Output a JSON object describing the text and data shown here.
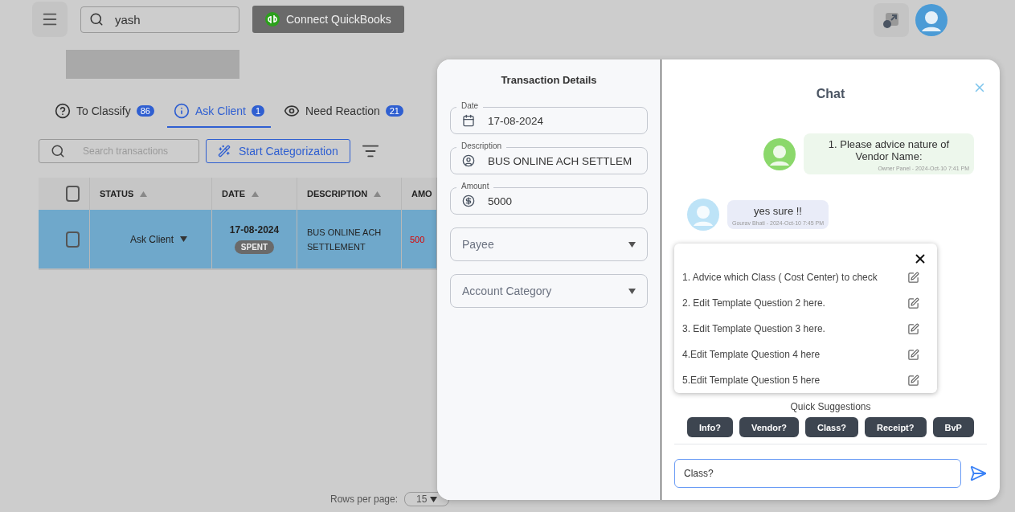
{
  "topbar": {
    "search_value": "yash",
    "connect_button": "Connect QuickBooks"
  },
  "tabs": [
    {
      "label": "To Classify",
      "count": "86",
      "selected": false
    },
    {
      "label": "Ask Client",
      "count": "1",
      "selected": true
    },
    {
      "label": "Need Reaction",
      "count": "21",
      "selected": false
    }
  ],
  "toolbar": {
    "search_placeholder": "Search transactions",
    "categorize_button": "Start Categorization"
  },
  "table": {
    "all_checked": false,
    "columns": [
      "STATUS",
      "DATE",
      "DESCRIPTION",
      "AMO"
    ],
    "rows": [
      {
        "selected": true,
        "checked": false,
        "status": "Ask Client",
        "date": "17-08-2024",
        "badge": "SPENT",
        "description": "BUS ONLINE ACH SETTLEMENT",
        "amount": "500"
      }
    ]
  },
  "pagination": {
    "label": "Rows per page:",
    "rows_per_page": "15"
  },
  "details": {
    "title": "Transaction Details",
    "fields": [
      {
        "kind": "text",
        "label": "Date",
        "value": "17-08-2024"
      },
      {
        "kind": "text",
        "label": "Description",
        "value": "BUS ONLINE ACH SETTLEM"
      },
      {
        "kind": "text",
        "label": "Amount",
        "value": "5000"
      },
      {
        "kind": "select",
        "placeholder": "Payee"
      },
      {
        "kind": "select",
        "placeholder": "Account Category"
      }
    ]
  },
  "chat": {
    "title": "Chat",
    "messages": [
      {
        "kind": "sent",
        "color": "#8bd86b",
        "text": "1. Please advice nature of Vendor Name:",
        "meta": "Owner Panel - 2024-Oct-10 7:41 PM"
      },
      {
        "kind": "received",
        "color": "#bde3f7",
        "text": "yes sure !!",
        "meta": "Gourav Bhati - 2024-Oct-10 7:45 PM"
      }
    ],
    "templates": [
      "1. Advice which Class ( Cost Center) to check",
      "2. Edit Template Question 2 here.",
      "3. Edit Template Question 3 here.",
      "4.Edit Template Question 4 here",
      "5.Edit Template Question 5 here"
    ],
    "suggestions_label": "Quick Suggestions",
    "chips": [
      "Info?",
      "Vendor?",
      "Class?",
      "Receipt?",
      "BvP"
    ],
    "input_value": "Class?"
  }
}
